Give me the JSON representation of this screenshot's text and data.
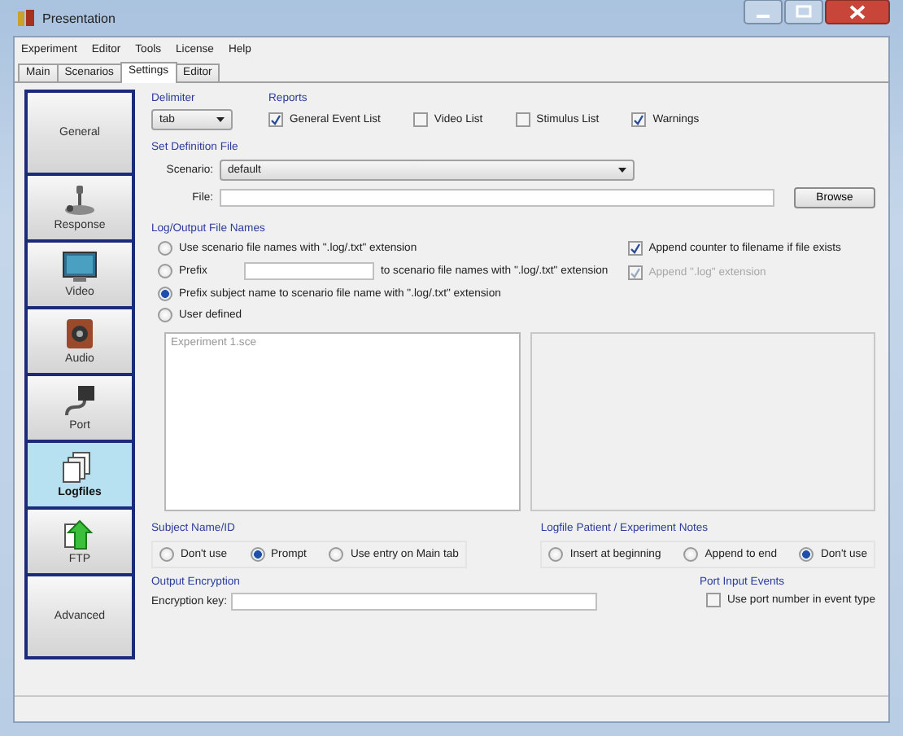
{
  "window": {
    "title": "Presentation"
  },
  "menu": [
    {
      "label": "Experiment"
    },
    {
      "label": "Editor"
    },
    {
      "label": "Tools"
    },
    {
      "label": "License"
    },
    {
      "label": "Help"
    }
  ],
  "tabs": [
    {
      "label": "Main",
      "selected": false
    },
    {
      "label": "Scenarios",
      "selected": false
    },
    {
      "label": "Settings",
      "selected": true
    },
    {
      "label": "Editor",
      "selected": false
    }
  ],
  "sidebar": {
    "items": [
      {
        "label": "General",
        "selected": false
      },
      {
        "label": "Response",
        "selected": false
      },
      {
        "label": "Video",
        "selected": false
      },
      {
        "label": "Audio",
        "selected": false
      },
      {
        "label": "Port",
        "selected": false
      },
      {
        "label": "Logfiles",
        "selected": true
      },
      {
        "label": "FTP",
        "selected": false
      },
      {
        "label": "Advanced",
        "selected": false
      }
    ]
  },
  "delimiter": {
    "label": "Delimiter",
    "value": "tab"
  },
  "reports": {
    "label": "Reports",
    "items": [
      {
        "label": "General Event List",
        "checked": true
      },
      {
        "label": "Video List",
        "checked": false
      },
      {
        "label": "Stimulus List",
        "checked": false
      },
      {
        "label": "Warnings",
        "checked": true
      }
    ]
  },
  "set_definition_file": {
    "label": "Set Definition File",
    "scenario_label": "Scenario:",
    "scenario_value": "default",
    "file_label": "File:",
    "browse_button": "Browse"
  },
  "log_output": {
    "label": "Log/Output File Names",
    "options": [
      {
        "kind": "plain",
        "label": "Use scenario file names with \".log/.txt\" extension",
        "selected": false
      },
      {
        "kind": "prefix",
        "label": "Prefix",
        "suffix": "to scenario file names with \".log/.txt\" extension",
        "selected": false
      },
      {
        "kind": "plain",
        "label": "Prefix subject name to scenario file name with \".log/.txt\" extension",
        "selected": true
      },
      {
        "kind": "plain",
        "label": "User defined",
        "selected": false
      }
    ],
    "checks": [
      {
        "label": "Append counter to filename if file exists",
        "checked": true,
        "disabled": false
      },
      {
        "label": "Append \".log\" extension",
        "checked": true,
        "disabled": true
      }
    ],
    "list_items": [
      "Experiment 1.sce"
    ]
  },
  "subject": {
    "label": "Subject Name/ID",
    "options": [
      {
        "label": "Don't use",
        "selected": false
      },
      {
        "label": "Prompt",
        "selected": true
      },
      {
        "label": "Use entry on Main tab",
        "selected": false
      }
    ]
  },
  "notes": {
    "label": "Logfile Patient / Experiment Notes",
    "options": [
      {
        "label": "Insert at beginning",
        "selected": false
      },
      {
        "label": "Append to end",
        "selected": false
      },
      {
        "label": "Don't use",
        "selected": true
      }
    ]
  },
  "encryption": {
    "label": "Output Encryption",
    "key_label": "Encryption key:"
  },
  "port_input": {
    "label": "Port Input Events",
    "option": {
      "label": "Use port number in event type",
      "checked": false
    }
  }
}
